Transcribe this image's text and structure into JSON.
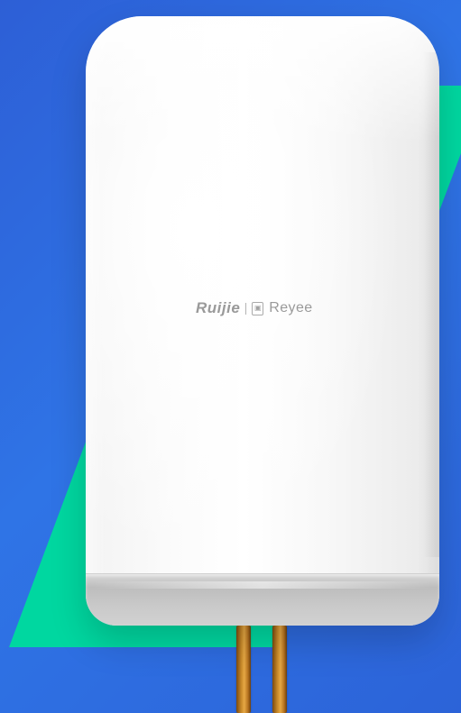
{
  "product": {
    "brand_primary": "Ruijie",
    "brand_secondary": "Reyee"
  },
  "colors": {
    "background_blue": "#2f6fe0",
    "accent_green": "#00d7a0",
    "device_white": "#ffffff",
    "band_gray": "#c4c4c4",
    "cable_copper": "#c98a2a"
  }
}
